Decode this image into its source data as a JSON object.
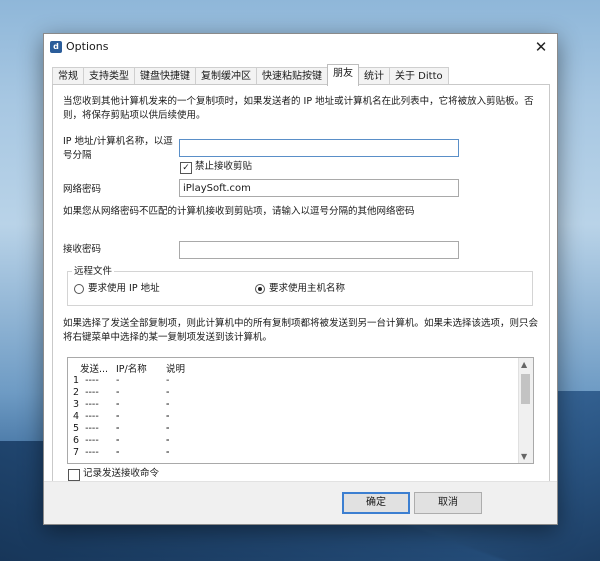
{
  "window": {
    "title": "Options",
    "close_symbol": "✕"
  },
  "tabs": [
    "常规",
    "支持类型",
    "键盘快捷键",
    "复制缓冲区",
    "快速粘贴按键",
    "朋友",
    "统计",
    "关于 Ditto"
  ],
  "active_tab_index": 5,
  "friends": {
    "description": "当您收到其他计算机发来的一个复制项时，如果发送者的 IP 地址或计算机名在此列表中，它将被放入剪贴板。否则，将保存剪贴项以供后续使用。",
    "ip_label": "IP 地址/计算机名称，以逗号分隔",
    "ip_value": "",
    "disable_receive_label": "禁止接收剪贴",
    "disable_receive_checked": true,
    "network_password_label": "网络密码",
    "network_password_value": "iPlaySoft.com",
    "mismatch_info": "如果您从网络密码不匹配的计算机接收到剪贴项，请输入以逗号分隔的其他网络密码",
    "receive_password_label": "接收密码",
    "receive_password_value": "",
    "remote_files": {
      "title": "远程文件",
      "option_ip": "要求使用 IP 地址",
      "option_hostname": "要求使用主机名称",
      "selected": "hostname"
    },
    "send_info": "如果选择了发送全部复制项，则此计算机中的所有复制项都将被发送到另一台计算机。如果未选择该选项，则只会将右键菜单中选择的某一复制项发送到该计算机。",
    "list": {
      "columns": [
        "发送...",
        "IP/名称",
        "说明"
      ],
      "rows": [
        {
          "num": "1",
          "ip": "----",
          "desc": "----"
        },
        {
          "num": "2",
          "ip": "----",
          "desc": "----"
        },
        {
          "num": "3",
          "ip": "----",
          "desc": "----"
        },
        {
          "num": "4",
          "ip": "----",
          "desc": "----"
        },
        {
          "num": "5",
          "ip": "----",
          "desc": "----"
        },
        {
          "num": "6",
          "ip": "----",
          "desc": "----"
        },
        {
          "num": "7",
          "ip": "----",
          "desc": "----"
        }
      ]
    },
    "log_label": "记录发送接收命令",
    "log_checked": false
  },
  "buttons": {
    "ok": "确定",
    "cancel": "取消"
  }
}
